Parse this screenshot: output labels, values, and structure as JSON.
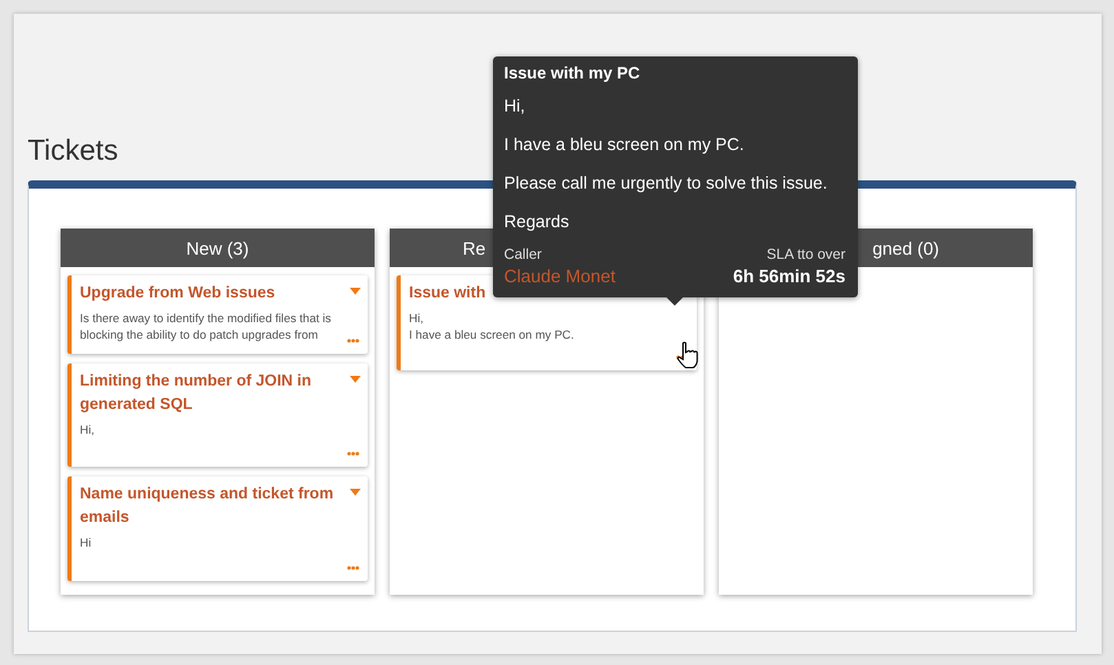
{
  "page_title": "Tickets",
  "columns": [
    {
      "header": "New (3)",
      "cards": [
        {
          "title": "Upgrade from Web issues",
          "lines": [
            "Is there away to identify the modified files that is blocking the ability to do patch upgrades from"
          ]
        },
        {
          "title": "Limiting the number of JOIN in generated SQL",
          "lines": [
            "Hi,"
          ]
        },
        {
          "title": "Name uniqueness and ticket from emails",
          "lines": [
            "Hi"
          ]
        }
      ]
    },
    {
      "header": "Re",
      "cards": [
        {
          "title": "Issue with",
          "lines": [
            "Hi,",
            "I have a bleu screen on my PC."
          ]
        }
      ]
    },
    {
      "header": "gned (0)"
    }
  ],
  "tooltip": {
    "title": "Issue with my PC",
    "paragraphs": [
      "Hi,",
      "I have a bleu screen on my PC.",
      "Please call me urgently to solve this issue.",
      "Regards"
    ],
    "caller_label": "Caller",
    "caller": "Claude Monet",
    "sla_label": "SLA tto over",
    "sla_value": "6h 56min 52s"
  }
}
